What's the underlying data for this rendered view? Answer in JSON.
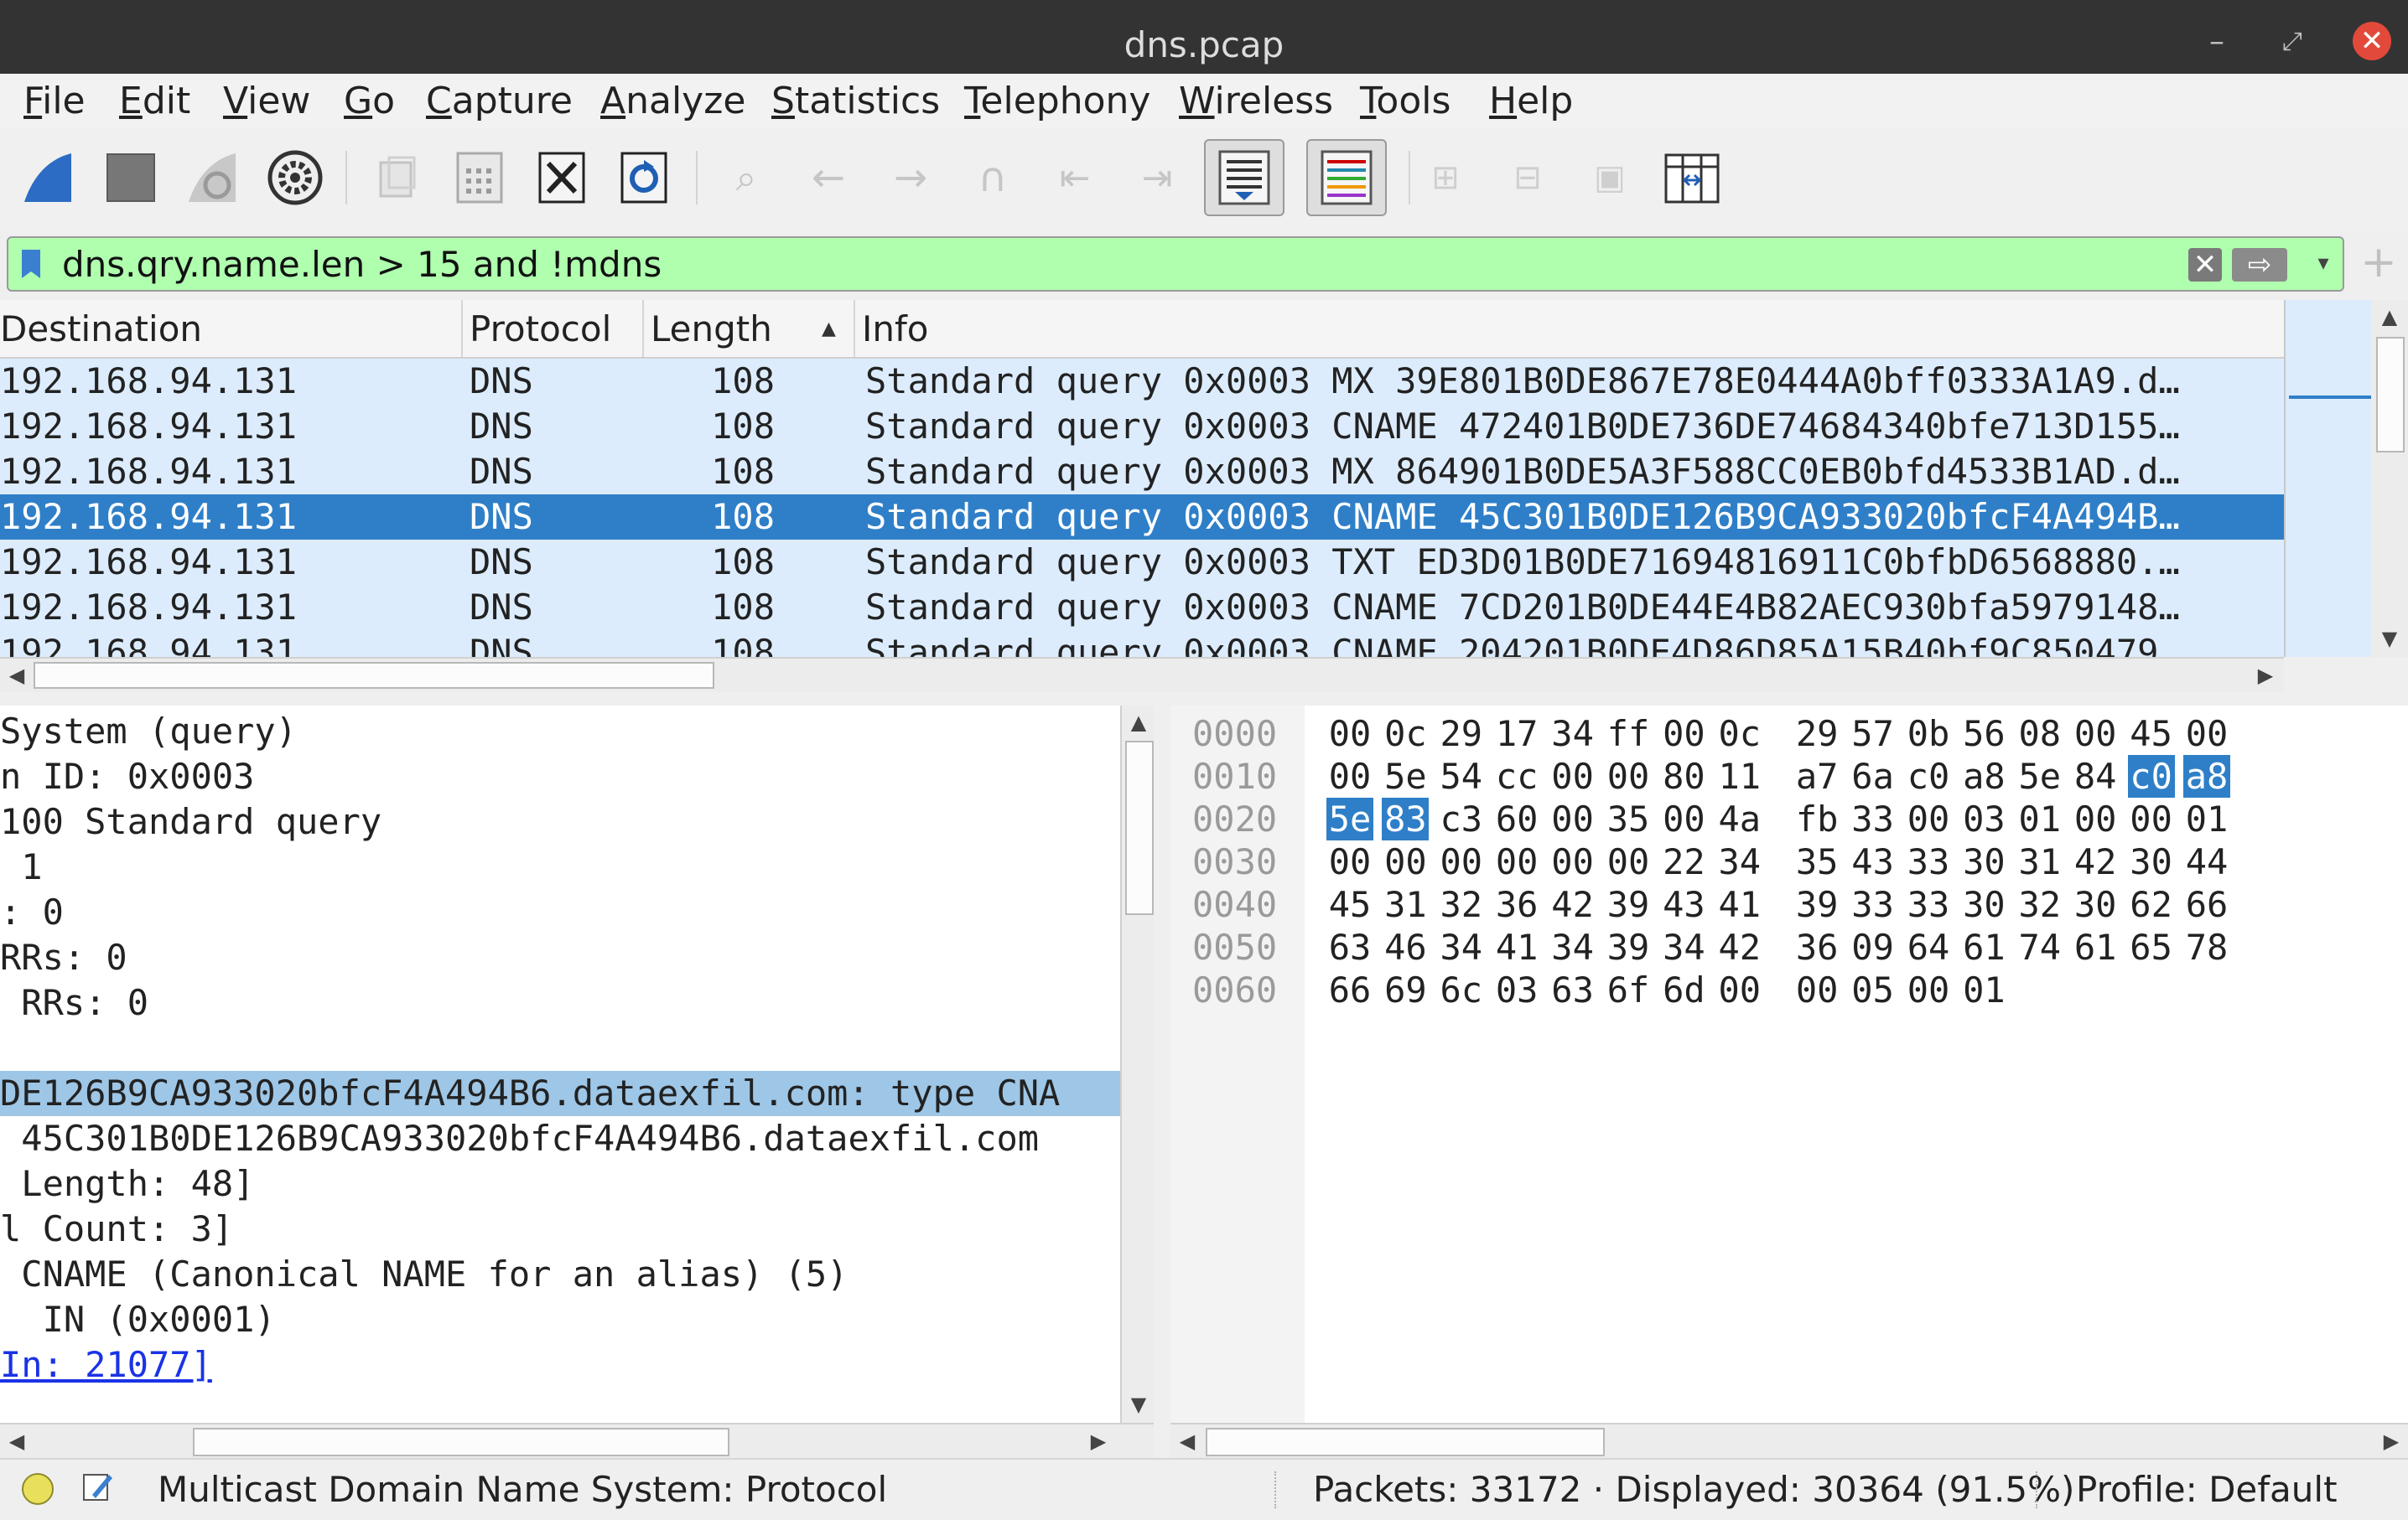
{
  "window": {
    "title": "dns.pcap"
  },
  "menu": [
    "File",
    "Edit",
    "View",
    "Go",
    "Capture",
    "Analyze",
    "Statistics",
    "Telephony",
    "Wireless",
    "Tools",
    "Help"
  ],
  "filter": {
    "text": "dns.qry.name.len > 15 and !mdns",
    "background": "#afffaf"
  },
  "packet_list": {
    "columns": [
      "Destination",
      "Protocol",
      "Length",
      "Info"
    ],
    "rows": [
      {
        "destination": "192.168.94.131",
        "protocol": "DNS",
        "length": "108",
        "info": "Standard query 0x0003 MX 39E801B0DE867E78E0444A0bff0333A1A9.d…",
        "selected": false
      },
      {
        "destination": "192.168.94.131",
        "protocol": "DNS",
        "length": "108",
        "info": "Standard query 0x0003 CNAME 472401B0DE736DE74684340bfe713D155…",
        "selected": false
      },
      {
        "destination": "192.168.94.131",
        "protocol": "DNS",
        "length": "108",
        "info": "Standard query 0x0003 MX 864901B0DE5A3F588CC0EB0bfd4533B1AD.d…",
        "selected": false
      },
      {
        "destination": "192.168.94.131",
        "protocol": "DNS",
        "length": "108",
        "info": "Standard query 0x0003 CNAME 45C301B0DE126B9CA933020bfcF4A494B…",
        "selected": true
      },
      {
        "destination": "192.168.94.131",
        "protocol": "DNS",
        "length": "108",
        "info": "Standard query 0x0003 TXT ED3D01B0DE71694816911C0bfbD6568880.…",
        "selected": false
      },
      {
        "destination": "192.168.94.131",
        "protocol": "DNS",
        "length": "108",
        "info": "Standard query 0x0003 CNAME 7CD201B0DE44E4B82AEC930bfa5979148…",
        "selected": false
      },
      {
        "destination": "192.168.94.131",
        "protocol": "DNS",
        "length": "108",
        "info": "Standard query 0x0003 CNAME 204201B0DE4D86D85A15B40bf9C850479…",
        "selected": false
      }
    ],
    "selected_color": "#2f7fc8",
    "row_color": "#dcecfd"
  },
  "details": {
    "rows": [
      {
        "text": "System (query)",
        "style": ""
      },
      {
        "text": "n ID: 0x0003",
        "style": ""
      },
      {
        "text": "100 Standard query",
        "style": ""
      },
      {
        "text": " 1",
        "style": ""
      },
      {
        "text": ": 0",
        "style": ""
      },
      {
        "text": "RRs: 0",
        "style": ""
      },
      {
        "text": " RRs: 0",
        "style": ""
      },
      {
        "text": "",
        "style": ""
      },
      {
        "text": "DE126B9CA933020bfcF4A494B6.dataexfil.com: type CNA",
        "style": "hl"
      },
      {
        "text": " 45C301B0DE126B9CA933020bfcF4A494B6.dataexfil.com",
        "style": ""
      },
      {
        "text": " Length: 48]",
        "style": ""
      },
      {
        "text": "l Count: 3]",
        "style": ""
      },
      {
        "text": " CNAME (Canonical NAME for an alias) (5)",
        "style": ""
      },
      {
        "text": "  IN (0x0001)",
        "style": ""
      },
      {
        "text": "In: 21077]",
        "style": "link"
      }
    ]
  },
  "bytes": {
    "rows": [
      {
        "offset": "0000",
        "hex": [
          "00",
          "0c",
          "29",
          "17",
          "34",
          "ff",
          "00",
          "0c",
          "29",
          "57",
          "0b",
          "56",
          "08",
          "00",
          "45",
          "00"
        ]
      },
      {
        "offset": "0010",
        "hex": [
          "00",
          "5e",
          "54",
          "cc",
          "00",
          "00",
          "80",
          "11",
          "a7",
          "6a",
          "c0",
          "a8",
          "5e",
          "84",
          "c0",
          "a8"
        ]
      },
      {
        "offset": "0020",
        "hex": [
          "5e",
          "83",
          "c3",
          "60",
          "00",
          "35",
          "00",
          "4a",
          "fb",
          "33",
          "00",
          "03",
          "01",
          "00",
          "00",
          "01"
        ]
      },
      {
        "offset": "0030",
        "hex": [
          "00",
          "00",
          "00",
          "00",
          "00",
          "00",
          "22",
          "34",
          "35",
          "43",
          "33",
          "30",
          "31",
          "42",
          "30",
          "44"
        ]
      },
      {
        "offset": "0040",
        "hex": [
          "45",
          "31",
          "32",
          "36",
          "42",
          "39",
          "43",
          "41",
          "39",
          "33",
          "33",
          "30",
          "32",
          "30",
          "62",
          "66"
        ]
      },
      {
        "offset": "0050",
        "hex": [
          "63",
          "46",
          "34",
          "41",
          "34",
          "39",
          "34",
          "42",
          "36",
          "09",
          "64",
          "61",
          "74",
          "61",
          "65",
          "78"
        ]
      },
      {
        "offset": "0060",
        "hex": [
          "66",
          "69",
          "6c",
          "03",
          "63",
          "6f",
          "6d",
          "00",
          "00",
          "05",
          "00",
          "01"
        ]
      }
    ],
    "selected": [
      [
        1,
        14
      ],
      [
        1,
        15
      ],
      [
        2,
        0
      ],
      [
        2,
        1
      ]
    ]
  },
  "status": {
    "message": "Multicast Domain Name System: Protocol",
    "packets": "Packets: 33172 · Displayed: 30364 (91.5%)",
    "profile": "Profile: Default"
  }
}
